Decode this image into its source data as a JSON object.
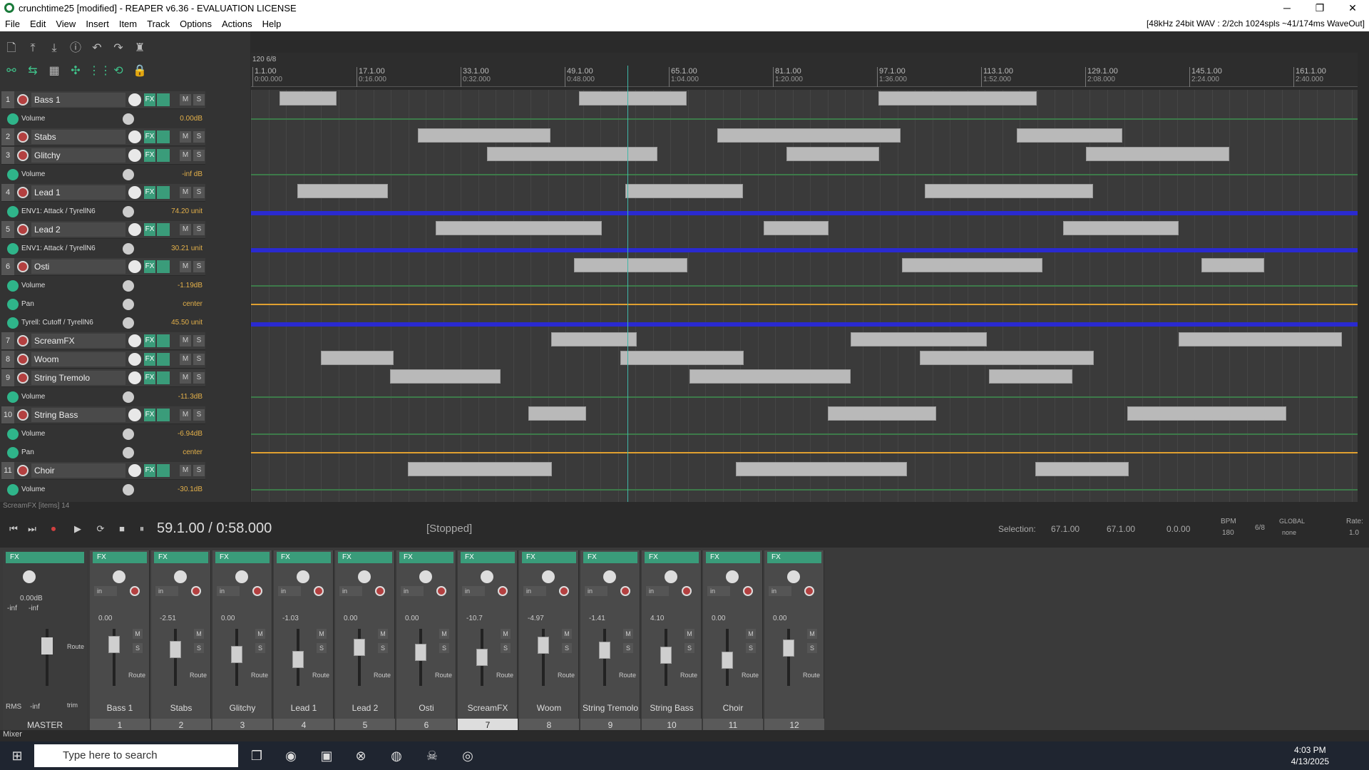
{
  "window": {
    "title": "crunchtime25 [modified] - REAPER v6.36 - EVALUATION LICENSE",
    "minimize": "─",
    "maximize": "❐",
    "close": "✕"
  },
  "menu": {
    "items": [
      "File",
      "Edit",
      "View",
      "Insert",
      "Item",
      "Track",
      "Options",
      "Actions",
      "Help"
    ],
    "status": "[48kHz 24bit WAV : 2/2ch 1024spls ~41/174ms WaveOut]"
  },
  "ruler": {
    "tempo": "120 6/8",
    "ticks": [
      {
        "bar": "1.1.00",
        "time": "0:00.000"
      },
      {
        "bar": "17.1.00",
        "time": "0:16.000"
      },
      {
        "bar": "33.1.00",
        "time": "0:32.000"
      },
      {
        "bar": "49.1.00",
        "time": "0:48.000"
      },
      {
        "bar": "65.1.00",
        "time": "1:04.000"
      },
      {
        "bar": "81.1.00",
        "time": "1:20.000"
      },
      {
        "bar": "97.1.00",
        "time": "1:36.000"
      },
      {
        "bar": "113.1.00",
        "time": "1:52.000"
      },
      {
        "bar": "129.1.00",
        "time": "2:08.000"
      },
      {
        "bar": "145.1.00",
        "time": "2:24.000"
      },
      {
        "bar": "161.1.00",
        "time": "2:40.000"
      }
    ]
  },
  "tracks": [
    {
      "kind": "track",
      "num": "1",
      "name": "Bass 1"
    },
    {
      "kind": "env",
      "name": "Volume",
      "value": "0.00dB"
    },
    {
      "kind": "track",
      "num": "2",
      "name": "Stabs"
    },
    {
      "kind": "track",
      "num": "3",
      "name": "Glitchy"
    },
    {
      "kind": "env",
      "name": "Volume",
      "value": "-inf dB"
    },
    {
      "kind": "track",
      "num": "4",
      "name": "Lead 1"
    },
    {
      "kind": "env",
      "name": "ENV1: Attack / TyrellN6",
      "value": "74.20 unit"
    },
    {
      "kind": "track",
      "num": "5",
      "name": "Lead 2"
    },
    {
      "kind": "env",
      "name": "ENV1: Attack / TyrellN6",
      "value": "30.21 unit"
    },
    {
      "kind": "track",
      "num": "6",
      "name": "Osti"
    },
    {
      "kind": "env",
      "name": "Volume",
      "value": "-1.19dB"
    },
    {
      "kind": "env",
      "name": "Pan",
      "value": "center"
    },
    {
      "kind": "env",
      "name": "Tyrell: Cutoff / TyrellN6",
      "value": "45.50 unit"
    },
    {
      "kind": "track",
      "num": "7",
      "name": "ScreamFX"
    },
    {
      "kind": "track",
      "num": "8",
      "name": "Woom"
    },
    {
      "kind": "track",
      "num": "9",
      "name": "String Tremolo"
    },
    {
      "kind": "env",
      "name": "Volume",
      "value": "-11.3dB"
    },
    {
      "kind": "track",
      "num": "10",
      "name": "String Bass"
    },
    {
      "kind": "env",
      "name": "Volume",
      "value": "-6.94dB"
    },
    {
      "kind": "env",
      "name": "Pan",
      "value": "center"
    },
    {
      "kind": "track",
      "num": "11",
      "name": "Choir"
    },
    {
      "kind": "env",
      "name": "Volume",
      "value": "-30.1dB"
    }
  ],
  "track_button_labels": {
    "fx": "FX",
    "mute": "M",
    "solo": "S"
  },
  "status_line": "ScreamFX [items] 14",
  "transport": {
    "position": "59.1.00 / 0:58.000",
    "state": "[Stopped]",
    "selection_label": "Selection:",
    "sel_start": "67.1.00",
    "sel_end": "67.1.00",
    "sel_len": "0.0.00",
    "bpm_label": "BPM",
    "bpm": "180",
    "timesig": "6/8",
    "global": "GLOBAL",
    "none": "none",
    "rate_label": "Rate:",
    "rate": "1.0"
  },
  "mixer": {
    "master": {
      "label": "MASTER",
      "vol": "0.00dB",
      "peakL": "-inf",
      "peakR": "-inf",
      "rms": "RMS",
      "rms_val": "-inf",
      "route": "Route",
      "trim": "trim"
    },
    "strips": [
      {
        "name": "Bass 1",
        "num": "1",
        "vol": "0.00"
      },
      {
        "name": "Stabs",
        "num": "2",
        "vol": "-2.51"
      },
      {
        "name": "Glitchy",
        "num": "3",
        "vol": "0.00"
      },
      {
        "name": "Lead 1",
        "num": "4",
        "vol": "-1.03"
      },
      {
        "name": "Lead 2",
        "num": "5",
        "vol": "0.00"
      },
      {
        "name": "Osti",
        "num": "6",
        "vol": "0.00"
      },
      {
        "name": "ScreamFX",
        "num": "7",
        "vol": "-10.7"
      },
      {
        "name": "Woom",
        "num": "8",
        "vol": "-4.97"
      },
      {
        "name": "String Tremolo",
        "num": "9",
        "vol": "-1.41"
      },
      {
        "name": "String Bass",
        "num": "10",
        "vol": "4.10"
      },
      {
        "name": "Choir",
        "num": "11",
        "vol": "0.00"
      },
      {
        "name": "",
        "num": "12",
        "vol": "0.00"
      }
    ],
    "fx_label": "FX",
    "in_label": "in",
    "route_label": "Route"
  },
  "mixer_tab": "Mixer",
  "taskbar": {
    "search_placeholder": "Type here to search",
    "time": "4:03 PM",
    "date": "4/13/2025"
  },
  "colors": {
    "accent": "#3a9c7a",
    "cursor": "#3fb7a8",
    "env_blue": "#2a2ad0",
    "env_orange": "#e0a030",
    "env_green": "#3d7a4a"
  }
}
